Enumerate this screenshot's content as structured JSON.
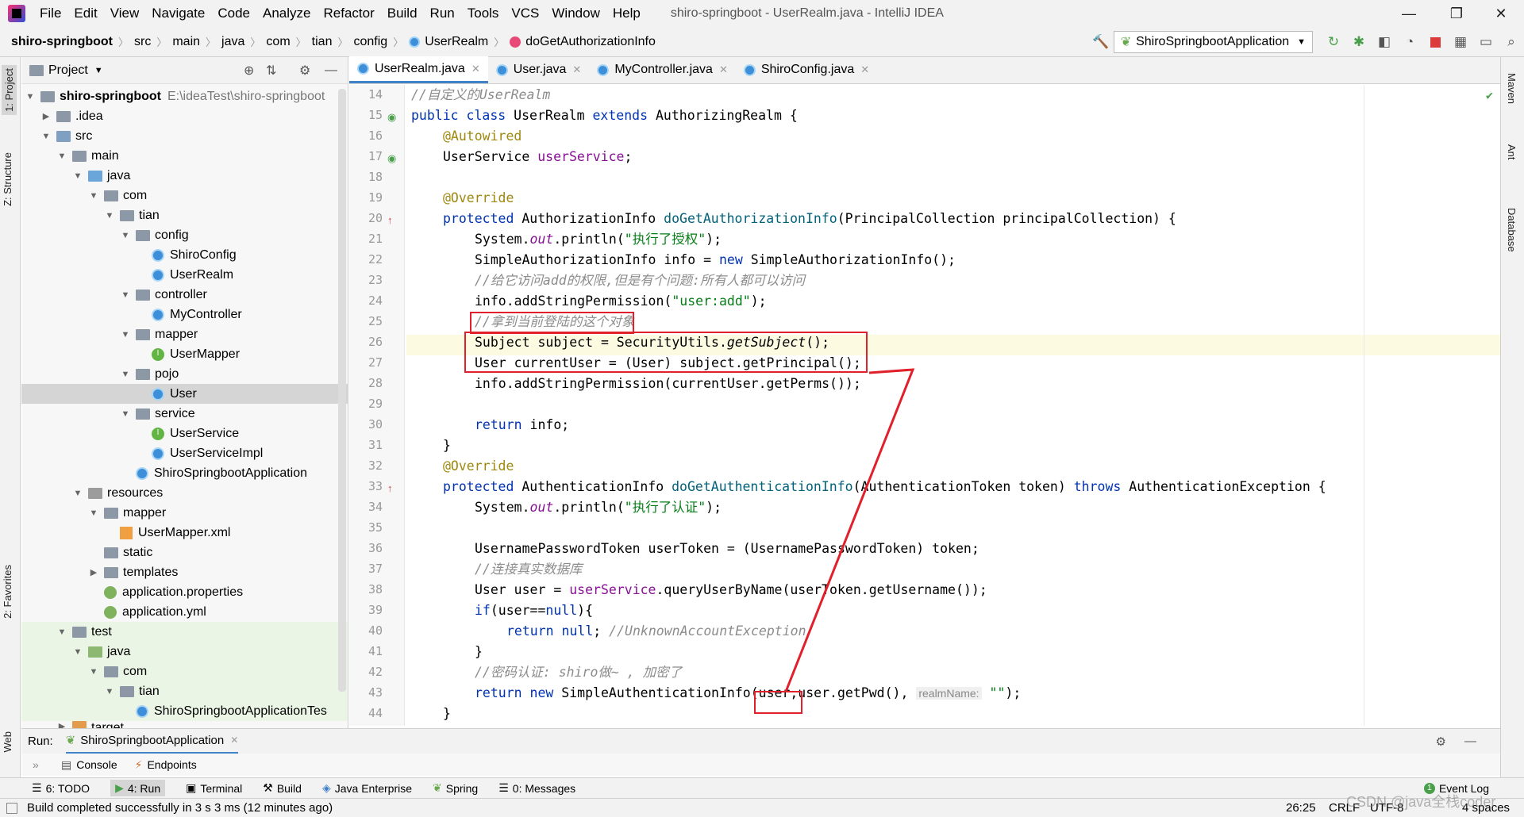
{
  "window": {
    "title": "shiro-springboot - UserRealm.java - IntelliJ IDEA",
    "menu": [
      "File",
      "Edit",
      "View",
      "Navigate",
      "Code",
      "Analyze",
      "Refactor",
      "Build",
      "Run",
      "Tools",
      "VCS",
      "Window",
      "Help"
    ]
  },
  "breadcrumb": [
    "shiro-springboot",
    "src",
    "main",
    "java",
    "com",
    "tian",
    "config",
    "UserRealm",
    "doGetAuthorizationInfo"
  ],
  "run_config": "ShiroSpringbootApplication",
  "left_tabs": [
    "1: Project",
    "Z: Structure",
    "2: Favorites",
    "Web"
  ],
  "right_tabs": [
    "Maven",
    "Ant",
    "Database"
  ],
  "project_panel": {
    "title": "Project",
    "root_name": "shiro-springboot",
    "root_path": "E:\\ideaTest\\shiro-springboot",
    "items": [
      ".idea",
      "src",
      "main",
      "java",
      "com",
      "tian",
      "config",
      "ShiroConfig",
      "UserRealm",
      "controller",
      "MyController",
      "mapper",
      "UserMapper",
      "pojo",
      "User",
      "service",
      "UserService",
      "UserServiceImpl",
      "ShiroSpringbootApplication",
      "resources",
      "mapper",
      "UserMapper.xml",
      "static",
      "templates",
      "application.properties",
      "application.yml",
      "test",
      "java",
      "com",
      "tian",
      "ShiroSpringbootApplicationTes",
      "target"
    ]
  },
  "editor_tabs": [
    "UserRealm.java",
    "User.java",
    "MyController.java",
    "ShiroConfig.java"
  ],
  "line_numbers": [
    "14",
    "15",
    "16",
    "17",
    "18",
    "19",
    "20",
    "21",
    "22",
    "23",
    "24",
    "25",
    "26",
    "27",
    "28",
    "29",
    "30",
    "31",
    "32",
    "33",
    "34",
    "35",
    "36",
    "37",
    "38",
    "39",
    "40",
    "41",
    "42",
    "43",
    "44"
  ],
  "code": {
    "l14": "//自定义的UserRealm",
    "l15": [
      "public class ",
      "UserRealm ",
      "extends ",
      "AuthorizingRealm {"
    ],
    "l16": "@Autowired",
    "l17": [
      "UserService ",
      "userService",
      ";"
    ],
    "l19": "@Override",
    "l20": [
      "protected ",
      "AuthorizationInfo ",
      "doGetAuthorizationInfo",
      "(PrincipalCollection principalCollection) {"
    ],
    "l21": [
      "System.",
      "out",
      ".println(",
      "\"执行了授权\"",
      ");"
    ],
    "l22": [
      "SimpleAuthorizationInfo info = ",
      "new ",
      "SimpleAuthorizationInfo();"
    ],
    "l23": "//给它访问add的权限,但是有个问题:所有人都可以访问",
    "l24": [
      "info.addStringPermission(",
      "\"user:add\"",
      ");"
    ],
    "l25": "//拿到当前登陆的这个对象",
    "l26": [
      "Subject subject = SecurityUtils.",
      "getSubject",
      "();"
    ],
    "l27": "User currentUser = (User) subject.getPrincipal();",
    "l28": "info.addStringPermission(currentUser.getPerms());",
    "l30": [
      "return ",
      "info;"
    ],
    "l31": "}",
    "l32": "@Override",
    "l33": [
      "protected ",
      "AuthenticationInfo ",
      "doGetAuthenticationInfo",
      "(AuthenticationToken token) ",
      "throws ",
      "AuthenticationException {"
    ],
    "l34": [
      "System.",
      "out",
      ".println(",
      "\"执行了认证\"",
      ");"
    ],
    "l36": "UsernamePasswordToken userToken = (UsernamePasswordToken) token;",
    "l37": "//连接真实数据库",
    "l38": [
      "User user = ",
      "userService",
      ".queryUserByName(userToken.getUsername());"
    ],
    "l39": [
      "if",
      "(user==",
      "null",
      "){"
    ],
    "l40": [
      "return ",
      "null",
      "; ",
      "//UnknownAccountException"
    ],
    "l41": "}",
    "l42": "//密码认证: shiro做~ , 加密了",
    "l43": [
      "return ",
      "new ",
      "SimpleAuthenticationInfo(user,user.getPwd(), ",
      "realmName:",
      " \"\"",
      ");"
    ],
    "l44": "}"
  },
  "run_panel": {
    "label": "Run:",
    "tab": "ShiroSpringbootApplication",
    "sub_tabs": [
      "Console",
      "Endpoints"
    ]
  },
  "bottom_tools": [
    "6: TODO",
    "4: Run",
    "Terminal",
    "Build",
    "Java Enterprise",
    "Spring",
    "0: Messages"
  ],
  "event_log": "Event Log",
  "status": {
    "message": "Build completed successfully in 3 s 3 ms (12 minutes ago)",
    "position": "26:25",
    "line_sep": "CRLF",
    "encoding": "UTF-8",
    "indent": "4 spaces",
    "watermark": "CSDN @java全栈coder"
  },
  "colors": {
    "keyword": "#0033b3",
    "annotation": "#9e880d",
    "comment": "#8c8c8c",
    "string": "#067d17",
    "method": "#00627a",
    "field": "#871094",
    "highlight_box": "#e0202a"
  }
}
